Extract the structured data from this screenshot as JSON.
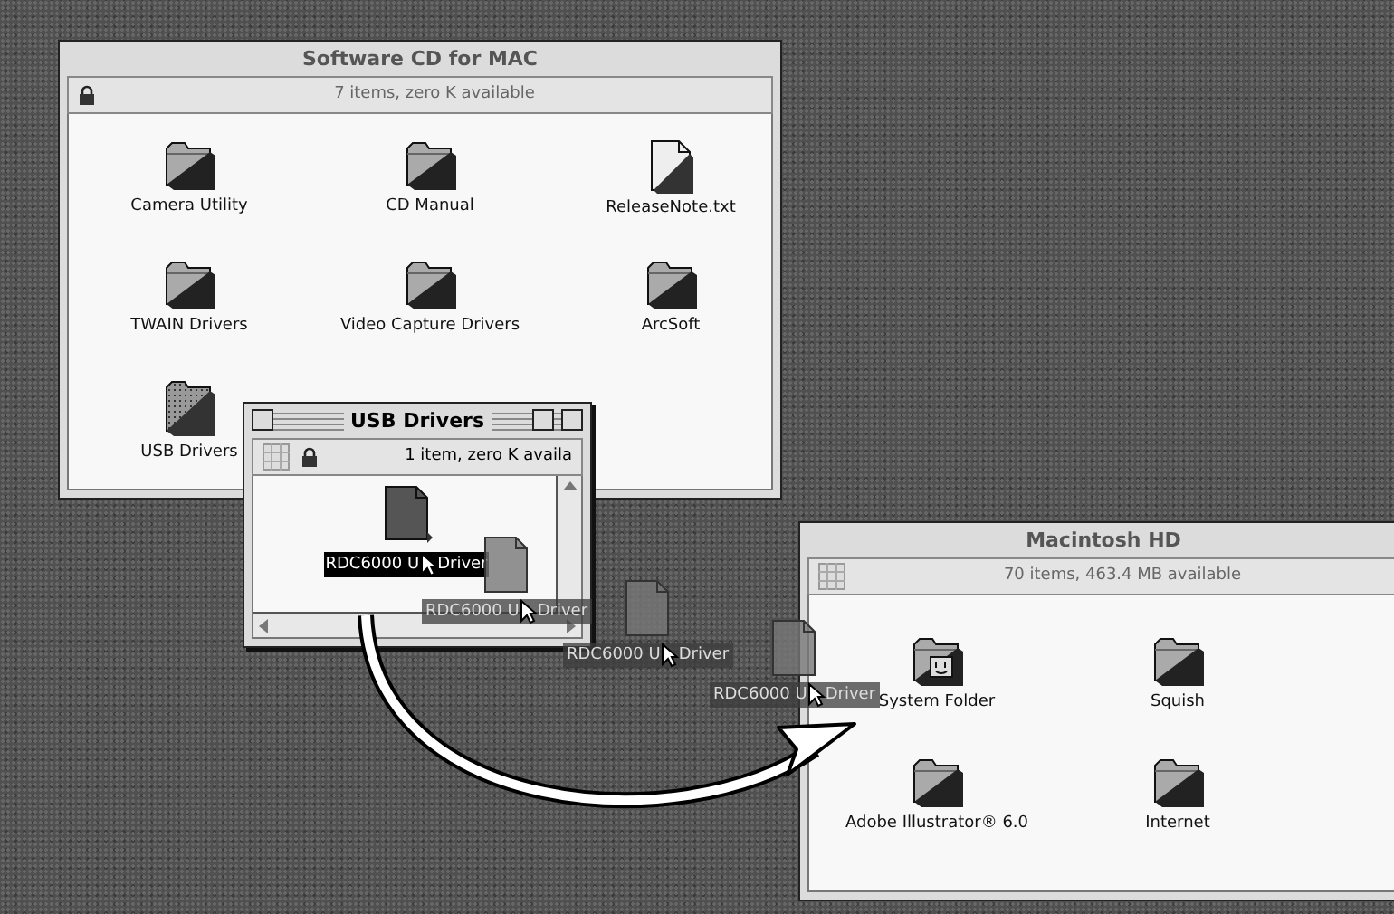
{
  "windows": [
    {
      "title": "Software CD for MAC",
      "active": false,
      "locked": true,
      "grid_view": false,
      "info": "7 items, zero K available",
      "items": [
        {
          "kind": "folder",
          "name": "Camera Utility",
          "selected": false
        },
        {
          "kind": "folder",
          "name": "CD Manual",
          "selected": false
        },
        {
          "kind": "document",
          "name": "ReleaseNote.txt",
          "selected": false
        },
        {
          "kind": "folder",
          "name": "TWAIN Drivers",
          "selected": false
        },
        {
          "kind": "folder",
          "name": "Video Capture Drivers",
          "selected": false
        },
        {
          "kind": "folder",
          "name": "ArcSoft",
          "selected": false
        },
        {
          "kind": "pattern-folder",
          "name": "USB Drivers",
          "selected": false
        }
      ]
    },
    {
      "title": "Macintosh HD",
      "active": false,
      "locked": false,
      "grid_view": true,
      "info": "70 items, 463.4 MB available",
      "items": [
        {
          "kind": "system-folder",
          "name": "System Folder",
          "selected": false
        },
        {
          "kind": "folder",
          "name": "Squish",
          "selected": false
        },
        {
          "kind": "folder",
          "name": "Adobe Illustrator® 6.0",
          "selected": false
        },
        {
          "kind": "folder",
          "name": "Internet",
          "selected": false
        }
      ]
    },
    {
      "title": "USB Drivers",
      "active": true,
      "locked": true,
      "grid_view": true,
      "info": "1 item, zero K availa",
      "items": [
        {
          "kind": "dark-document",
          "name_start": "RDC6000 U",
          "name_end": "Driver",
          "selected": true
        }
      ]
    }
  ],
  "drag_ghosts": [
    {
      "name_start": "RDC6000 U",
      "name_end": "Driver"
    },
    {
      "name_start": "RDC6000 U",
      "name_end": "Driver"
    },
    {
      "name_start": "RDC6000 U",
      "name_end": "Driver"
    }
  ]
}
